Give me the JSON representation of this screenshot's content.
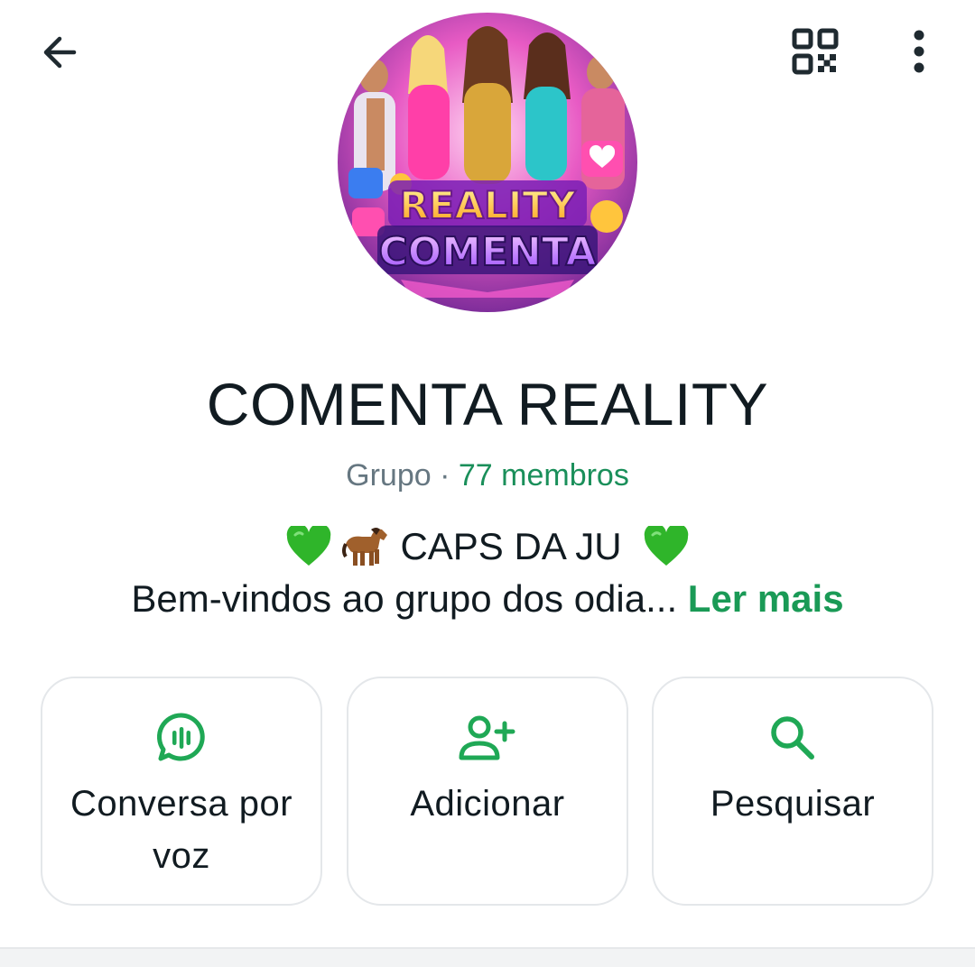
{
  "header": {
    "back_icon": "arrow-left-icon",
    "qr_icon": "qr-code-icon",
    "menu_icon": "more-vertical-icon"
  },
  "avatar": {
    "title_line1": "REALITY",
    "title_line2": "COMENTA"
  },
  "group": {
    "name": "COMENTA REALITY",
    "kind": "Grupo",
    "separator": " · ",
    "members": "77 membros"
  },
  "description": {
    "line1": "CAPS DA JU",
    "line2": "Bem-vindos ao grupo dos odia...",
    "read_more": "Ler mais",
    "emojis": [
      "green-heart-icon",
      "horse-icon",
      "green-heart-icon"
    ]
  },
  "actions": [
    {
      "label": "Conversa por voz",
      "icon": "voice-chat-icon"
    },
    {
      "label": "Adicionar",
      "icon": "add-person-icon"
    },
    {
      "label": "Pesquisar",
      "icon": "search-icon"
    }
  ],
  "colors": {
    "accent": "#1a9a56",
    "members_text": "#1a8f5a",
    "icon_green": "#1fa855",
    "text_primary": "#111b21",
    "text_secondary": "#667781"
  }
}
